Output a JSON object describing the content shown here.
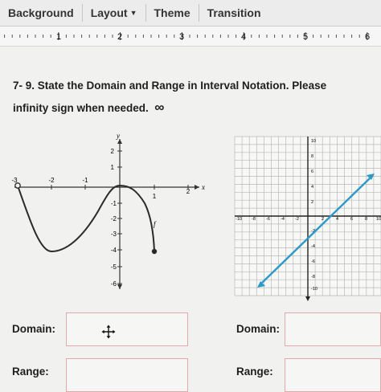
{
  "menubar": {
    "items": [
      {
        "label": "Background"
      },
      {
        "label": "Layout"
      },
      {
        "label": "Theme"
      },
      {
        "label": "Transition"
      }
    ]
  },
  "ruler": {
    "numbers": [
      "1",
      "2",
      "3",
      "4",
      "5",
      "6"
    ]
  },
  "question": {
    "line1": "7- 9.  State the Domain and Range in Interval Notation.  Please",
    "line2": "infinity sign when needed.",
    "symbol": "∞"
  },
  "graph_left": {
    "axis_x_label": "x",
    "axis_y_label": "y",
    "curve_label": "f",
    "x_ticks": [
      "-3",
      "-2",
      "-1",
      "1",
      "2"
    ],
    "y_ticks": [
      "2",
      "1",
      "-1",
      "-2",
      "-3",
      "-4",
      "-5",
      "-6"
    ]
  },
  "graph_right": {
    "x_ticks": [
      "-10",
      "-8",
      "-6",
      "-4",
      "-2",
      "2",
      "4",
      "6",
      "8",
      "10"
    ],
    "y_ticks": [
      "10",
      "8",
      "6",
      "4",
      "2",
      "-2",
      "-4",
      "-6",
      "-8",
      "-10"
    ],
    "line_color": "#2b9ac8"
  },
  "answers": {
    "domain_label": "Domain:",
    "range_label": "Range:"
  }
}
